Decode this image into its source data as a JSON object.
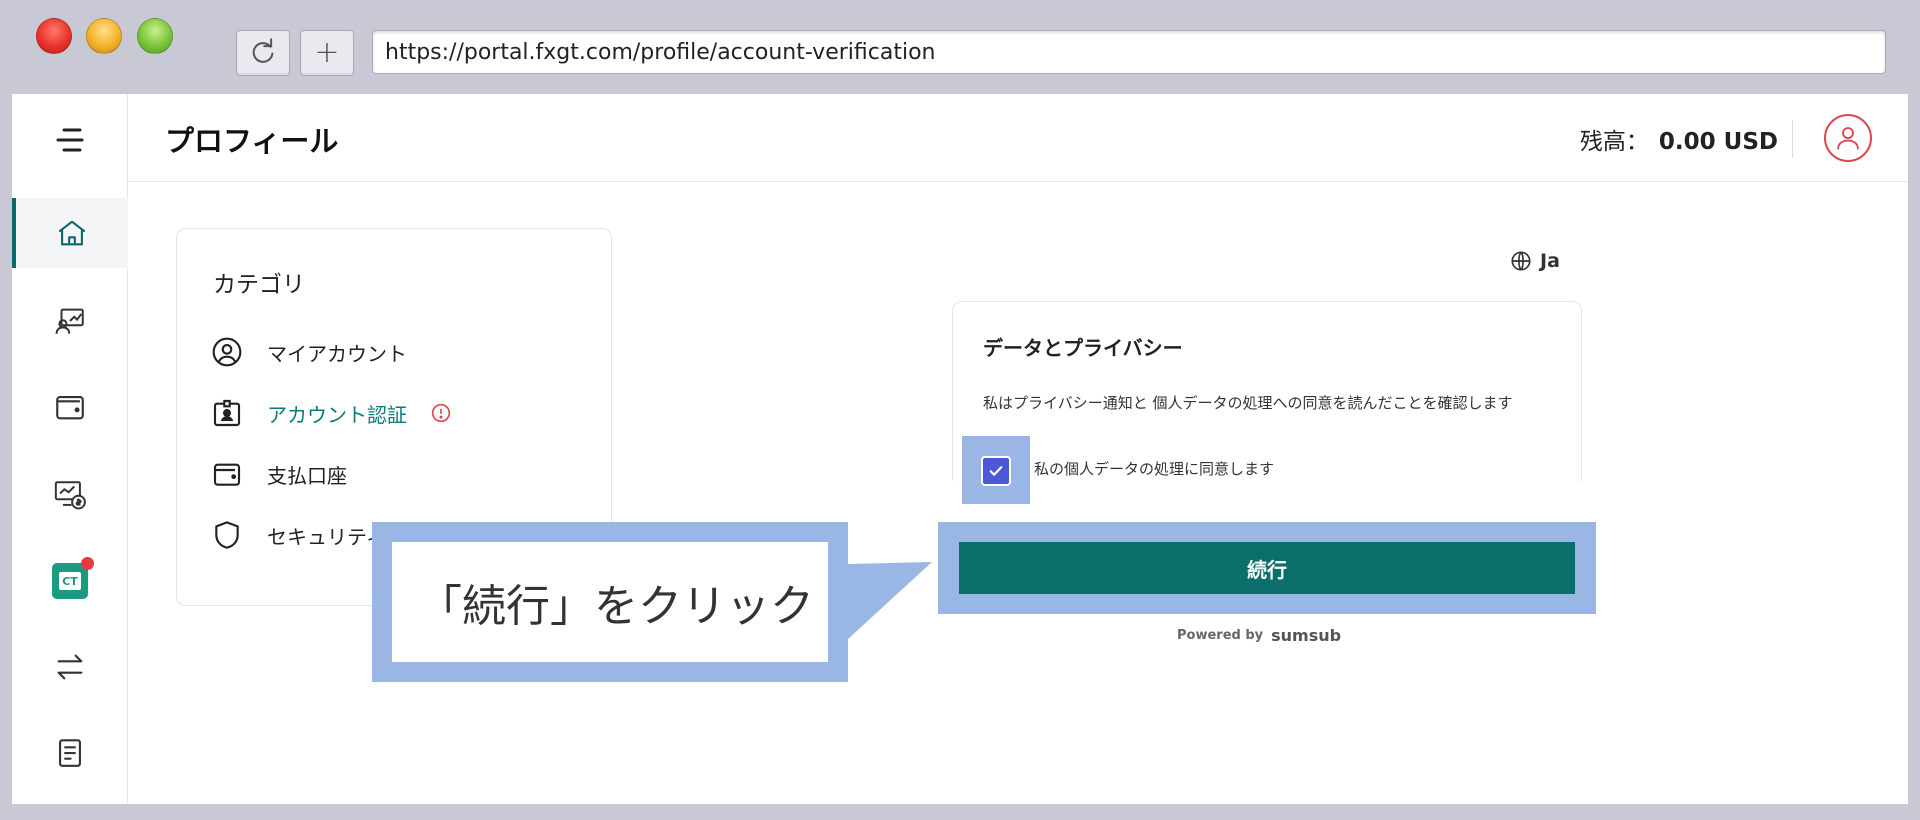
{
  "browser": {
    "url": "https://portal.fxgt.com/profile/account-verification"
  },
  "header": {
    "title": "プロフィール",
    "balance_label": "残高：",
    "balance_amount": "0.00",
    "balance_currency": "USD"
  },
  "categories": {
    "title": "カテゴリ",
    "items": [
      {
        "label": "マイアカウント",
        "icon": "user-circle-icon"
      },
      {
        "label": "アカウント認証",
        "icon": "id-card-icon",
        "active": true
      },
      {
        "label": "支払口座",
        "icon": "wallet-icon"
      },
      {
        "label": "セキュリティ",
        "icon": "shield-icon"
      }
    ]
  },
  "verification": {
    "language": "Ja",
    "title": "データとプライバシー",
    "notice": "私はプライバシー通知と 個人データの処理への同意を読んだことを確認します",
    "consent_label": "私の個人データの処理に同意します",
    "consent_checked": true,
    "continue_label": "続行",
    "powered_by": "Powered by",
    "powered_brand": "sumsub"
  },
  "callout": {
    "text": "「続行」をクリック"
  },
  "colors": {
    "accent": "#0a6e6b",
    "highlight": "#9ab6e4",
    "checkbox": "#4b59d9",
    "warning": "#e0464f"
  }
}
